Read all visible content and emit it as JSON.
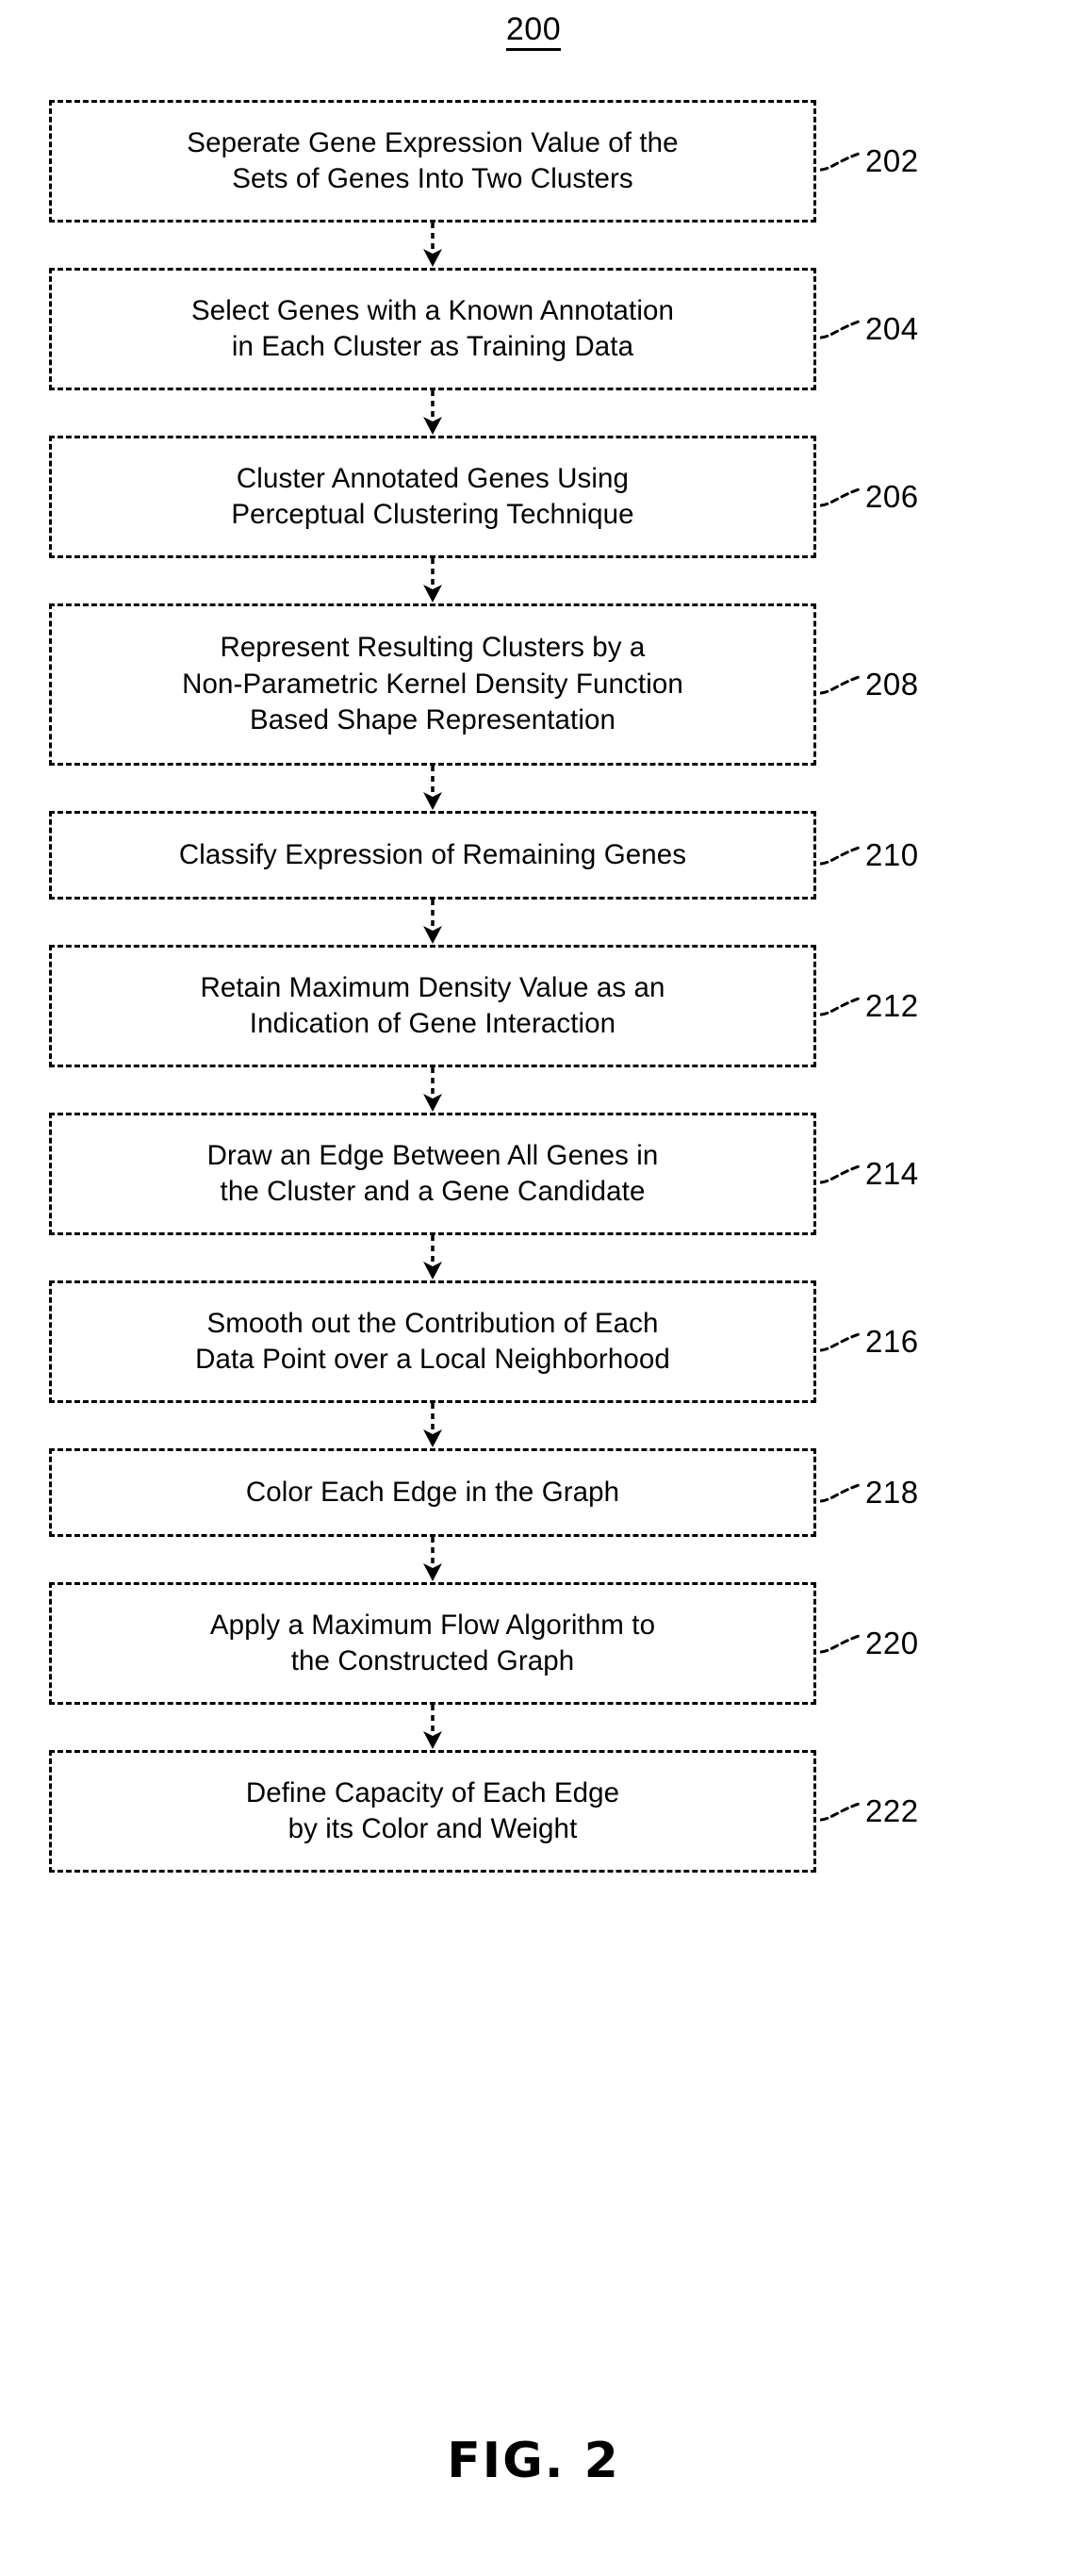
{
  "figure": {
    "diagram_number": "200",
    "caption": "FIG. 2"
  },
  "colors": {
    "stroke": "#000000",
    "background": "#ffffff"
  },
  "flowchart": {
    "type": "process-flow",
    "orientation": "vertical",
    "border_style": "dashed",
    "connector_style": "dashed-line-with-solid-arrowhead",
    "steps": [
      {
        "ref": "202",
        "text": "Seperate Gene Expression Value of the\nSets of Genes Into Two Clusters",
        "lines": 2
      },
      {
        "ref": "204",
        "text": "Select Genes with a Known Annotation\nin Each Cluster as Training Data",
        "lines": 2
      },
      {
        "ref": "206",
        "text": "Cluster Annotated Genes Using\nPerceptual Clustering Technique",
        "lines": 2
      },
      {
        "ref": "208",
        "text": "Represent Resulting Clusters by a\nNon-Parametric Kernel Density Function\nBased Shape Representation",
        "lines": 3
      },
      {
        "ref": "210",
        "text": "Classify Expression of Remaining Genes",
        "lines": 1
      },
      {
        "ref": "212",
        "text": "Retain Maximum Density Value as an\nIndication of Gene Interaction",
        "lines": 2
      },
      {
        "ref": "214",
        "text": "Draw an Edge Between All Genes in\nthe Cluster and a Gene Candidate",
        "lines": 2
      },
      {
        "ref": "216",
        "text": "Smooth out the Contribution of Each\nData Point over a Local Neighborhood",
        "lines": 2
      },
      {
        "ref": "218",
        "text": "Color Each Edge in the Graph",
        "lines": 1
      },
      {
        "ref": "220",
        "text": "Apply a Maximum Flow Algorithm to\nthe Constructed Graph",
        "lines": 2
      },
      {
        "ref": "222",
        "text": "Define Capacity of Each Edge\nby its Color and Weight",
        "lines": 2
      }
    ]
  }
}
